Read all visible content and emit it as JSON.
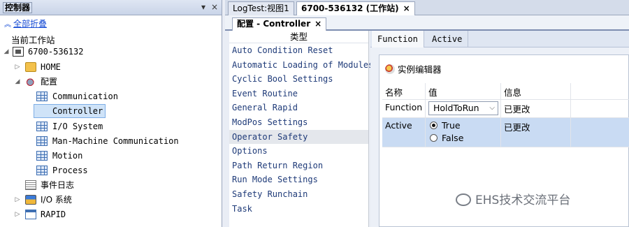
{
  "left_panel": {
    "title": "控制器",
    "pin_icon": "pin-icon",
    "close_icon": "close-icon",
    "collapse_all": "全部折叠",
    "current_station": "当前工作站",
    "tree": {
      "station": "6700-536132",
      "home": "HOME",
      "config": "配置",
      "config_items": [
        "Communication",
        "Controller",
        "I/O System",
        "Man-Machine Communication",
        "Motion",
        "Process"
      ],
      "event_log": "事件日志",
      "io_system": "I/O 系统",
      "rapid": "RAPID"
    }
  },
  "doc_tabs": {
    "tab1": "LogTest:视图1",
    "tab2": "6700-536132 (工作站)",
    "tab2_close": "×"
  },
  "sub_tabs": {
    "config_tab": "配置 - Controller",
    "config_close": "×"
  },
  "type_list": {
    "header": "类型",
    "items": [
      "Auto Condition Reset",
      "Automatic Loading of Modules",
      "Cyclic Bool Settings",
      "Event Routine",
      "General Rapid",
      "ModPos Settings",
      "Operator Safety",
      "Options",
      "Path Return Region",
      "Run Mode Settings",
      "Safety Runchain",
      "Task"
    ],
    "selected": "Operator Safety"
  },
  "instance_tabs": [
    "Function",
    "Active"
  ],
  "editor": {
    "title": "实例编辑器",
    "columns": [
      "名称",
      "值",
      "信息"
    ],
    "rows": {
      "function": {
        "name": "Function",
        "value": "HoldToRun",
        "info": "已更改"
      },
      "active": {
        "name": "Active",
        "options": [
          "True",
          "False"
        ],
        "selected": "True",
        "info": "已更改"
      }
    }
  },
  "watermark": "EHS技术交流平台"
}
